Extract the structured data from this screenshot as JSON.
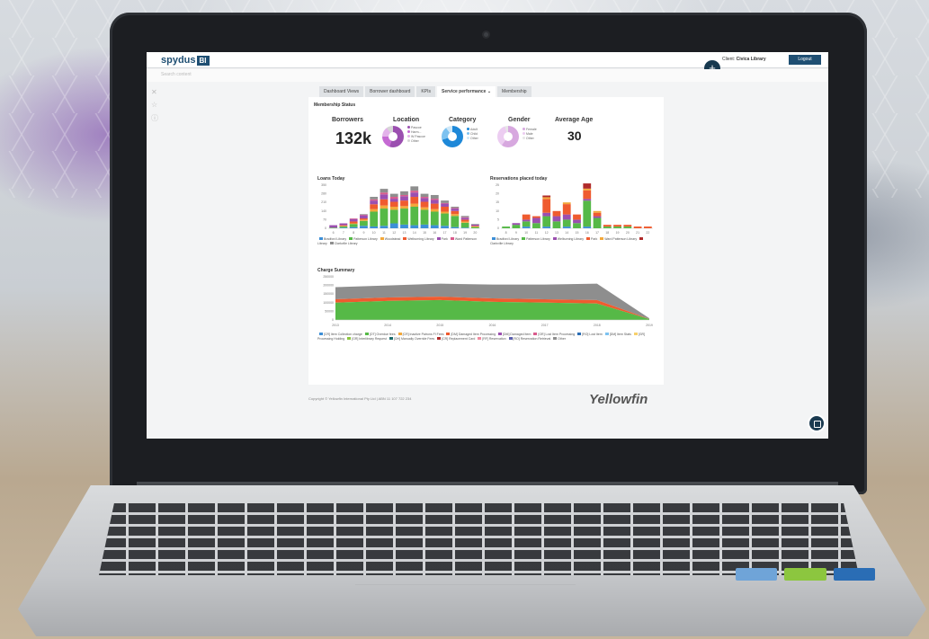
{
  "app": {
    "logo_text": "spydus",
    "logo_badge": "BI",
    "client_label": "Client:",
    "client_name": "Civica Library",
    "logout_label": "Logout",
    "add_button": "+",
    "search_placeholder": "Search content"
  },
  "tabs": [
    {
      "label": "Dashboard Views",
      "active": false
    },
    {
      "label": "Borrower dashboard",
      "active": false
    },
    {
      "label": "KPIs",
      "active": false
    },
    {
      "label": "Service performance ⌄",
      "active": true
    },
    {
      "label": "Membership",
      "active": false
    }
  ],
  "membership": {
    "section_title": "Membership Status",
    "borrowers_label": "Borrowers",
    "borrowers_value": "132k",
    "location_label": "Location",
    "category_label": "Category",
    "gender_label": "Gender",
    "avg_age_label": "Average Age",
    "avg_age_value": "30",
    "location_legend": [
      "Pascoe",
      "Harm...",
      "W Pascoe",
      "Other"
    ],
    "category_legend": [
      "Adult",
      "Child",
      "Other"
    ],
    "gender_legend": [
      "Female",
      "Male",
      "Other"
    ]
  },
  "chart_data": [
    {
      "type": "bar",
      "title": "Loans Today",
      "categories": [
        "6",
        "7",
        "8",
        "9",
        "10",
        "11",
        "12",
        "13",
        "14",
        "15",
        "16",
        "17",
        "18",
        "19",
        "20"
      ],
      "ylim": [
        0,
        350
      ],
      "series": [
        {
          "name": "Bradford Library",
          "color": "#3d8fd6",
          "values": [
            0,
            5,
            10,
            20,
            15,
            20,
            40,
            30,
            25,
            30,
            25,
            20,
            10,
            5,
            0
          ]
        },
        {
          "name": "Patterson Library",
          "color": "#56b947",
          "values": [
            5,
            10,
            25,
            40,
            120,
            140,
            110,
            130,
            150,
            120,
            110,
            100,
            90,
            40,
            10
          ]
        },
        {
          "name": "Woodstead",
          "color": "#f2a83a",
          "values": [
            0,
            5,
            5,
            10,
            20,
            25,
            25,
            20,
            25,
            20,
            20,
            15,
            15,
            10,
            5
          ]
        },
        {
          "name": "Welburning Library",
          "color": "#ef5b2f",
          "values": [
            0,
            5,
            15,
            10,
            40,
            50,
            40,
            45,
            55,
            45,
            45,
            40,
            25,
            15,
            5
          ]
        },
        {
          "name": "Park",
          "color": "#9b4fb0",
          "values": [
            20,
            15,
            20,
            25,
            30,
            40,
            25,
            35,
            35,
            30,
            30,
            25,
            20,
            15,
            10
          ]
        },
        {
          "name": "Ward Patterson Library",
          "color": "#d95b8c",
          "values": [
            0,
            0,
            5,
            5,
            10,
            15,
            15,
            10,
            15,
            10,
            10,
            5,
            5,
            5,
            0
          ]
        },
        {
          "name": "Clarkville Library",
          "color": "#8e8e8e",
          "values": [
            0,
            0,
            0,
            5,
            20,
            30,
            25,
            30,
            35,
            25,
            30,
            20,
            10,
            10,
            5
          ]
        }
      ]
    },
    {
      "type": "bar",
      "title": "Reservations placed today",
      "categories": [
        "8",
        "9",
        "10",
        "11",
        "12",
        "13",
        "14",
        "15",
        "16",
        "17",
        "18",
        "19",
        "20",
        "21",
        "22"
      ],
      "ylim": [
        0,
        25
      ],
      "series": [
        {
          "name": "Bradford Library",
          "color": "#3d8fd6",
          "values": [
            0,
            0,
            1,
            0,
            1,
            0,
            1,
            0,
            1,
            0,
            0,
            0,
            0,
            0,
            0
          ]
        },
        {
          "name": "Patterson Library",
          "color": "#56b947",
          "values": [
            1,
            2,
            3,
            3,
            6,
            4,
            4,
            3,
            15,
            6,
            1,
            1,
            1,
            0,
            0
          ]
        },
        {
          "name": "Welburning Library",
          "color": "#9b4fb0",
          "values": [
            0,
            1,
            1,
            3,
            2,
            3,
            3,
            2,
            1,
            1,
            0,
            0,
            0,
            0,
            0
          ]
        },
        {
          "name": "Park",
          "color": "#ef5b2f",
          "values": [
            0,
            0,
            3,
            1,
            8,
            3,
            6,
            3,
            5,
            2,
            1,
            1,
            1,
            1,
            1
          ]
        },
        {
          "name": "Ward Patterson Library",
          "color": "#f2a83a",
          "values": [
            0,
            0,
            0,
            0,
            1,
            0,
            1,
            0,
            1,
            1,
            0,
            0,
            0,
            0,
            0
          ]
        },
        {
          "name": "Clarkville Library",
          "color": "#b02b2b",
          "values": [
            0,
            0,
            0,
            0,
            1,
            0,
            0,
            0,
            3,
            0,
            0,
            0,
            0,
            0,
            0
          ]
        }
      ]
    },
    {
      "type": "area",
      "title": "Charge Summary",
      "categories": [
        "2013",
        "2014",
        "2015",
        "2016",
        "2017",
        "2018",
        "2019"
      ],
      "ylim": [
        0,
        250000
      ],
      "series": [
        {
          "name": "[CR] Item Collection charge",
          "color": "#56b947",
          "values": [
            100000,
            110000,
            115000,
            105000,
            100000,
            95000,
            5000
          ]
        },
        {
          "name": "[DM] Damaged Item",
          "color": "#ef5b2f",
          "values": [
            20000,
            20000,
            20000,
            20000,
            20000,
            20000,
            1000
          ]
        },
        {
          "name": "Other",
          "color": "#8e8e8e",
          "values": [
            70000,
            70000,
            75000,
            80000,
            85000,
            95000,
            4000
          ]
        }
      ]
    }
  ],
  "legends": {
    "loans": [
      "Bradford Library",
      "Patterson Library",
      "Woodstead",
      "Welburning Library",
      "Park",
      "Ward Patterson Library",
      "Clarkville Library"
    ],
    "reservations": [
      "Bradford Library",
      "Patterson Library",
      "Welburning Library",
      "Park",
      "Ward Patterson Library",
      "Clarkville Library"
    ],
    "charges": [
      "[CR] Item Collection charge",
      "[OT] Overdue fees",
      "[CR] Inactive Patrons FI Fees",
      "[DM] Damaged Item Processing",
      "[DM] Damaged Item",
      "[GR] Lost Item Processing",
      "[RO] Lost Item",
      "[DM] Item Stats",
      "[GR] Processing Holding",
      "[GR] Interlibrary Request",
      "[OH] Manually Override Fees",
      "[CR] Replacement Card",
      "[RF] Reservation",
      "[RO] Reservation Retrieval",
      "Other"
    ]
  },
  "footer": {
    "copyright": "Copyright © Yellowfin International Pty Ltd | ABN 11 107 722 234",
    "brand": "Yellowfin"
  },
  "colors": {
    "navy": "#1f4f73",
    "accent_green": "#56b947",
    "accent_orange": "#ef5b2f",
    "accent_purple": "#9b4fb0",
    "accent_blue": "#3d8fd6",
    "gray": "#8e8e8e"
  }
}
